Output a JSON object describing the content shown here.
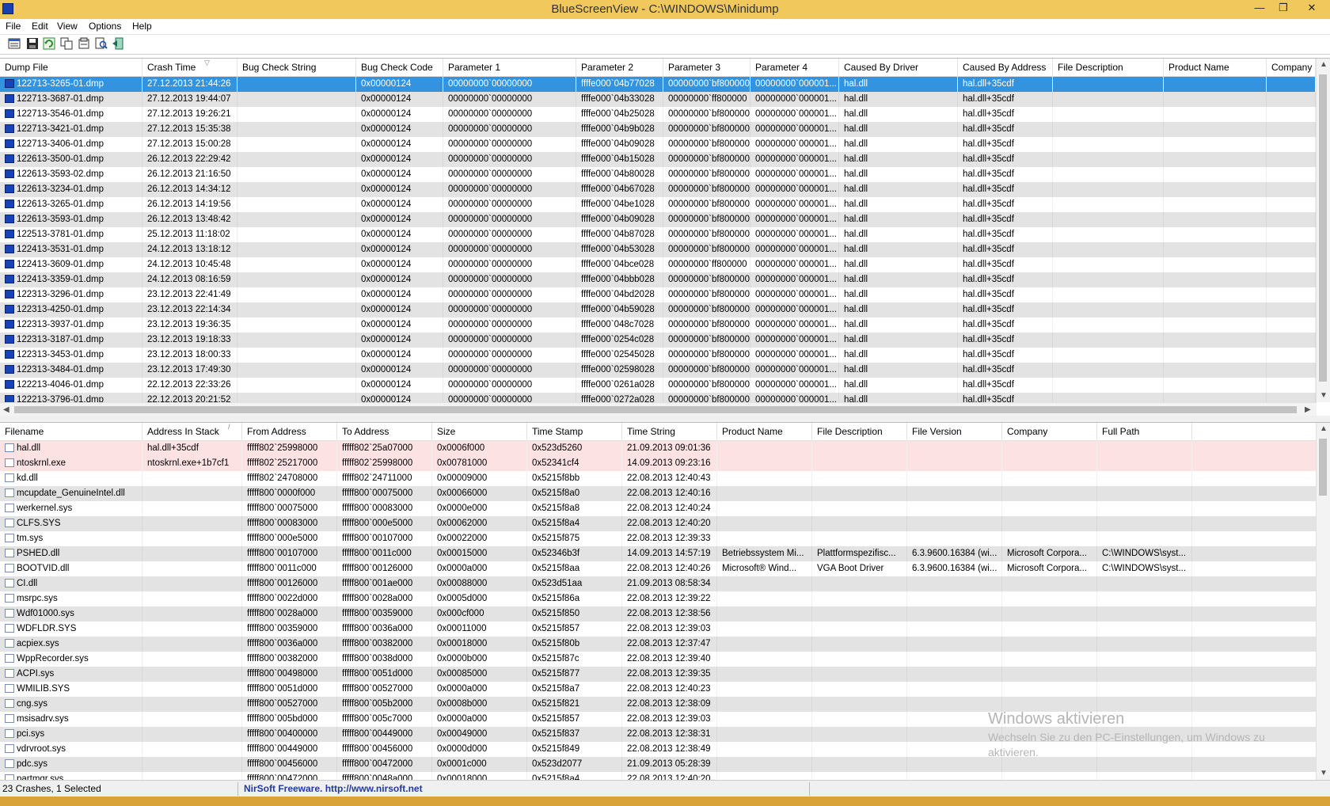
{
  "window": {
    "title": "BlueScreenView - C:\\WINDOWS\\Minidump",
    "buttons": [
      "—",
      "❐",
      "✕"
    ]
  },
  "menu": [
    "File",
    "Edit",
    "View",
    "Options",
    "Help"
  ],
  "toolbar": [
    "properties-icon",
    "save-icon",
    "refresh-icon",
    "copy-icon",
    "options-icon",
    "find-icon",
    "exit-icon"
  ],
  "upper": {
    "columns": [
      "Dump File",
      "Crash Time",
      "Bug Check String",
      "Bug Check Code",
      "Parameter 1",
      "Parameter 2",
      "Parameter 3",
      "Parameter 4",
      "Caused By Driver",
      "Caused By Address",
      "File Description",
      "Product Name",
      "Company"
    ],
    "sort_indicator": "▽",
    "rows": [
      [
        "122713-3265-01.dmp",
        "27.12.2013 21:44:26",
        "",
        "0x00000124",
        "00000000`00000000",
        "ffffe000`04b77028",
        "00000000`bf800000",
        "00000000`000001...",
        "hal.dll",
        "hal.dll+35cdf",
        "",
        "",
        ""
      ],
      [
        "122713-3687-01.dmp",
        "27.12.2013 19:44:07",
        "",
        "0x00000124",
        "00000000`00000000",
        "ffffe000`04b33028",
        "00000000`ff800000",
        "00000000`000001...",
        "hal.dll",
        "hal.dll+35cdf",
        "",
        "",
        ""
      ],
      [
        "122713-3546-01.dmp",
        "27.12.2013 19:26:21",
        "",
        "0x00000124",
        "00000000`00000000",
        "ffffe000`04b25028",
        "00000000`bf800000",
        "00000000`000001...",
        "hal.dll",
        "hal.dll+35cdf",
        "",
        "",
        ""
      ],
      [
        "122713-3421-01.dmp",
        "27.12.2013 15:35:38",
        "",
        "0x00000124",
        "00000000`00000000",
        "ffffe000`04b9b028",
        "00000000`bf800000",
        "00000000`000001...",
        "hal.dll",
        "hal.dll+35cdf",
        "",
        "",
        ""
      ],
      [
        "122713-3406-01.dmp",
        "27.12.2013 15:00:28",
        "",
        "0x00000124",
        "00000000`00000000",
        "ffffe000`04b09028",
        "00000000`bf800000",
        "00000000`000001...",
        "hal.dll",
        "hal.dll+35cdf",
        "",
        "",
        ""
      ],
      [
        "122613-3500-01.dmp",
        "26.12.2013 22:29:42",
        "",
        "0x00000124",
        "00000000`00000000",
        "ffffe000`04b15028",
        "00000000`bf800000",
        "00000000`000001...",
        "hal.dll",
        "hal.dll+35cdf",
        "",
        "",
        ""
      ],
      [
        "122613-3593-02.dmp",
        "26.12.2013 21:16:50",
        "",
        "0x00000124",
        "00000000`00000000",
        "ffffe000`04b80028",
        "00000000`bf800000",
        "00000000`000001...",
        "hal.dll",
        "hal.dll+35cdf",
        "",
        "",
        ""
      ],
      [
        "122613-3234-01.dmp",
        "26.12.2013 14:34:12",
        "",
        "0x00000124",
        "00000000`00000000",
        "ffffe000`04b67028",
        "00000000`bf800000",
        "00000000`000001...",
        "hal.dll",
        "hal.dll+35cdf",
        "",
        "",
        ""
      ],
      [
        "122613-3265-01.dmp",
        "26.12.2013 14:19:56",
        "",
        "0x00000124",
        "00000000`00000000",
        "ffffe000`04be1028",
        "00000000`bf800000",
        "00000000`000001...",
        "hal.dll",
        "hal.dll+35cdf",
        "",
        "",
        ""
      ],
      [
        "122613-3593-01.dmp",
        "26.12.2013 13:48:42",
        "",
        "0x00000124",
        "00000000`00000000",
        "ffffe000`04b09028",
        "00000000`bf800000",
        "00000000`000001...",
        "hal.dll",
        "hal.dll+35cdf",
        "",
        "",
        ""
      ],
      [
        "122513-3781-01.dmp",
        "25.12.2013 11:18:02",
        "",
        "0x00000124",
        "00000000`00000000",
        "ffffe000`04b87028",
        "00000000`bf800000",
        "00000000`000001...",
        "hal.dll",
        "hal.dll+35cdf",
        "",
        "",
        ""
      ],
      [
        "122413-3531-01.dmp",
        "24.12.2013 13:18:12",
        "",
        "0x00000124",
        "00000000`00000000",
        "ffffe000`04b53028",
        "00000000`bf800000",
        "00000000`000001...",
        "hal.dll",
        "hal.dll+35cdf",
        "",
        "",
        ""
      ],
      [
        "122413-3609-01.dmp",
        "24.12.2013 10:45:48",
        "",
        "0x00000124",
        "00000000`00000000",
        "ffffe000`04bce028",
        "00000000`ff800000",
        "00000000`000001...",
        "hal.dll",
        "hal.dll+35cdf",
        "",
        "",
        ""
      ],
      [
        "122413-3359-01.dmp",
        "24.12.2013 08:16:59",
        "",
        "0x00000124",
        "00000000`00000000",
        "ffffe000`04bbb028",
        "00000000`bf800000",
        "00000000`000001...",
        "hal.dll",
        "hal.dll+35cdf",
        "",
        "",
        ""
      ],
      [
        "122313-3296-01.dmp",
        "23.12.2013 22:41:49",
        "",
        "0x00000124",
        "00000000`00000000",
        "ffffe000`04bd2028",
        "00000000`bf800000",
        "00000000`000001...",
        "hal.dll",
        "hal.dll+35cdf",
        "",
        "",
        ""
      ],
      [
        "122313-4250-01.dmp",
        "23.12.2013 22:14:34",
        "",
        "0x00000124",
        "00000000`00000000",
        "ffffe000`04b59028",
        "00000000`bf800000",
        "00000000`000001...",
        "hal.dll",
        "hal.dll+35cdf",
        "",
        "",
        ""
      ],
      [
        "122313-3937-01.dmp",
        "23.12.2013 19:36:35",
        "",
        "0x00000124",
        "00000000`00000000",
        "ffffe000`048c7028",
        "00000000`bf800000",
        "00000000`000001...",
        "hal.dll",
        "hal.dll+35cdf",
        "",
        "",
        ""
      ],
      [
        "122313-3187-01.dmp",
        "23.12.2013 19:18:33",
        "",
        "0x00000124",
        "00000000`00000000",
        "ffffe000`0254c028",
        "00000000`bf800000",
        "00000000`000001...",
        "hal.dll",
        "hal.dll+35cdf",
        "",
        "",
        ""
      ],
      [
        "122313-3453-01.dmp",
        "23.12.2013 18:00:33",
        "",
        "0x00000124",
        "00000000`00000000",
        "ffffe000`02545028",
        "00000000`bf800000",
        "00000000`000001...",
        "hal.dll",
        "hal.dll+35cdf",
        "",
        "",
        ""
      ],
      [
        "122313-3484-01.dmp",
        "23.12.2013 17:49:30",
        "",
        "0x00000124",
        "00000000`00000000",
        "ffffe000`02598028",
        "00000000`bf800000",
        "00000000`000001...",
        "hal.dll",
        "hal.dll+35cdf",
        "",
        "",
        ""
      ],
      [
        "122213-4046-01.dmp",
        "22.12.2013 22:33:26",
        "",
        "0x00000124",
        "00000000`00000000",
        "ffffe000`0261a028",
        "00000000`bf800000",
        "00000000`000001...",
        "hal.dll",
        "hal.dll+35cdf",
        "",
        "",
        ""
      ],
      [
        "122213-3796-01.dmp",
        "22.12.2013 20:21:52",
        "",
        "0x00000124",
        "00000000`00000000",
        "ffffe000`0272a028",
        "00000000`bf800000",
        "00000000`000001...",
        "hal.dll",
        "hal.dll+35cdf",
        "",
        "",
        ""
      ]
    ]
  },
  "lower": {
    "columns": [
      "Filename",
      "Address In Stack",
      "From Address",
      "To Address",
      "Size",
      "Time Stamp",
      "Time String",
      "Product Name",
      "File Description",
      "File Version",
      "Company",
      "Full Path"
    ],
    "sort_indicator": "/",
    "rows": [
      [
        "hal.dll",
        "hal.dll+35cdf",
        "fffff802`25998000",
        "fffff802`25a07000",
        "0x0006f000",
        "0x523d5260",
        "21.09.2013 09:01:36",
        "",
        "",
        "",
        "",
        ""
      ],
      [
        "ntoskrnl.exe",
        "ntoskrnl.exe+1b7cf1",
        "fffff802`25217000",
        "fffff802`25998000",
        "0x00781000",
        "0x52341cf4",
        "14.09.2013 09:23:16",
        "",
        "",
        "",
        "",
        ""
      ],
      [
        "kd.dll",
        "",
        "fffff802`24708000",
        "fffff802`24711000",
        "0x00009000",
        "0x5215f8bb",
        "22.08.2013 12:40:43",
        "",
        "",
        "",
        "",
        ""
      ],
      [
        "mcupdate_GenuineIntel.dll",
        "",
        "fffff800`0000f000",
        "fffff800`00075000",
        "0x00066000",
        "0x5215f8a0",
        "22.08.2013 12:40:16",
        "",
        "",
        "",
        "",
        ""
      ],
      [
        "werkernel.sys",
        "",
        "fffff800`00075000",
        "fffff800`00083000",
        "0x0000e000",
        "0x5215f8a8",
        "22.08.2013 12:40:24",
        "",
        "",
        "",
        "",
        ""
      ],
      [
        "CLFS.SYS",
        "",
        "fffff800`00083000",
        "fffff800`000e5000",
        "0x00062000",
        "0x5215f8a4",
        "22.08.2013 12:40:20",
        "",
        "",
        "",
        "",
        ""
      ],
      [
        "tm.sys",
        "",
        "fffff800`000e5000",
        "fffff800`00107000",
        "0x00022000",
        "0x5215f875",
        "22.08.2013 12:39:33",
        "",
        "",
        "",
        "",
        ""
      ],
      [
        "PSHED.dll",
        "",
        "fffff800`00107000",
        "fffff800`0011c000",
        "0x00015000",
        "0x52346b3f",
        "14.09.2013 14:57:19",
        "Betriebssystem Mi...",
        "Plattformspezifisc...",
        "6.3.9600.16384 (wi...",
        "Microsoft Corpora...",
        "C:\\WINDOWS\\syst..."
      ],
      [
        "BOOTVID.dll",
        "",
        "fffff800`0011c000",
        "fffff800`00126000",
        "0x0000a000",
        "0x5215f8aa",
        "22.08.2013 12:40:26",
        "Microsoft® Wind...",
        "VGA Boot Driver",
        "6.3.9600.16384 (wi...",
        "Microsoft Corpora...",
        "C:\\WINDOWS\\syst..."
      ],
      [
        "CI.dll",
        "",
        "fffff800`00126000",
        "fffff800`001ae000",
        "0x00088000",
        "0x523d51aa",
        "21.09.2013 08:58:34",
        "",
        "",
        "",
        "",
        ""
      ],
      [
        "msrpc.sys",
        "",
        "fffff800`0022d000",
        "fffff800`0028a000",
        "0x0005d000",
        "0x5215f86a",
        "22.08.2013 12:39:22",
        "",
        "",
        "",
        "",
        ""
      ],
      [
        "Wdf01000.sys",
        "",
        "fffff800`0028a000",
        "fffff800`00359000",
        "0x000cf000",
        "0x5215f850",
        "22.08.2013 12:38:56",
        "",
        "",
        "",
        "",
        ""
      ],
      [
        "WDFLDR.SYS",
        "",
        "fffff800`00359000",
        "fffff800`0036a000",
        "0x00011000",
        "0x5215f857",
        "22.08.2013 12:39:03",
        "",
        "",
        "",
        "",
        ""
      ],
      [
        "acpiex.sys",
        "",
        "fffff800`0036a000",
        "fffff800`00382000",
        "0x00018000",
        "0x5215f80b",
        "22.08.2013 12:37:47",
        "",
        "",
        "",
        "",
        ""
      ],
      [
        "WppRecorder.sys",
        "",
        "fffff800`00382000",
        "fffff800`0038d000",
        "0x0000b000",
        "0x5215f87c",
        "22.08.2013 12:39:40",
        "",
        "",
        "",
        "",
        ""
      ],
      [
        "ACPI.sys",
        "",
        "fffff800`00498000",
        "fffff800`0051d000",
        "0x00085000",
        "0x5215f877",
        "22.08.2013 12:39:35",
        "",
        "",
        "",
        "",
        ""
      ],
      [
        "WMILIB.SYS",
        "",
        "fffff800`0051d000",
        "fffff800`00527000",
        "0x0000a000",
        "0x5215f8a7",
        "22.08.2013 12:40:23",
        "",
        "",
        "",
        "",
        ""
      ],
      [
        "cng.sys",
        "",
        "fffff800`00527000",
        "fffff800`005b2000",
        "0x0008b000",
        "0x5215f821",
        "22.08.2013 12:38:09",
        "",
        "",
        "",
        "",
        ""
      ],
      [
        "msisadrv.sys",
        "",
        "fffff800`005bd000",
        "fffff800`005c7000",
        "0x0000a000",
        "0x5215f857",
        "22.08.2013 12:39:03",
        "",
        "",
        "",
        "",
        ""
      ],
      [
        "pci.sys",
        "",
        "fffff800`00400000",
        "fffff800`00449000",
        "0x00049000",
        "0x5215f837",
        "22.08.2013 12:38:31",
        "",
        "",
        "",
        "",
        ""
      ],
      [
        "vdrvroot.sys",
        "",
        "fffff800`00449000",
        "fffff800`00456000",
        "0x0000d000",
        "0x5215f849",
        "22.08.2013 12:38:49",
        "",
        "",
        "",
        "",
        ""
      ],
      [
        "pdc.sys",
        "",
        "fffff800`00456000",
        "fffff800`00472000",
        "0x0001c000",
        "0x523d2077",
        "21.09.2013 05:28:39",
        "",
        "",
        "",
        "",
        ""
      ],
      [
        "partmgr.sys",
        "",
        "fffff800`00472000",
        "fffff800`0048a000",
        "0x00018000",
        "0x5215f8a4",
        "22.08.2013 12:40:20",
        "",
        "",
        "",
        "",
        ""
      ]
    ]
  },
  "status": {
    "count": "23 Crashes, 1 Selected",
    "link": "NirSoft Freeware.  http://www.nirsoft.net"
  },
  "watermark": {
    "title": "Windows aktivieren",
    "text": "Wechseln Sie zu den PC-Einstellungen, um Windows zu aktivieren."
  },
  "colors": {
    "titlebar": "#f0c85c",
    "selection": "#3393df",
    "highlight_rows": "#fde2e4",
    "alt_row": "#e3e3e3",
    "link": "#1f3aa5"
  }
}
